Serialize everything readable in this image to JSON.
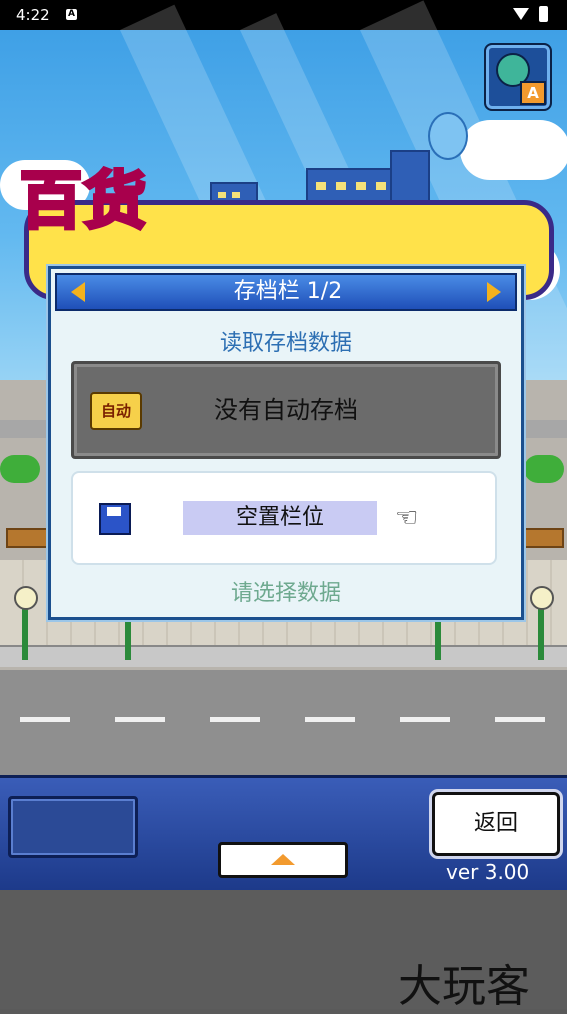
{
  "status_bar": {
    "time": "4:22",
    "notification_letter": "A"
  },
  "translate_button": {
    "badge": "A"
  },
  "dialog": {
    "title": "存档栏 1/2",
    "subtitle": "读取存档数据",
    "auto_slot": {
      "icon_text": "自动",
      "label": "没有自动存档"
    },
    "empty_slot": {
      "label": "空置栏位"
    },
    "hint": "请选择数据"
  },
  "panel": {
    "back_label": "返回",
    "version": "ver 3.00"
  },
  "watermark": "大玩客",
  "colors": {
    "dialog_header": "#1f4fb8",
    "accent_arrow": "#f3b21e",
    "panel_bg": "#1d3a8a",
    "hint_text": "#6ea98f"
  }
}
